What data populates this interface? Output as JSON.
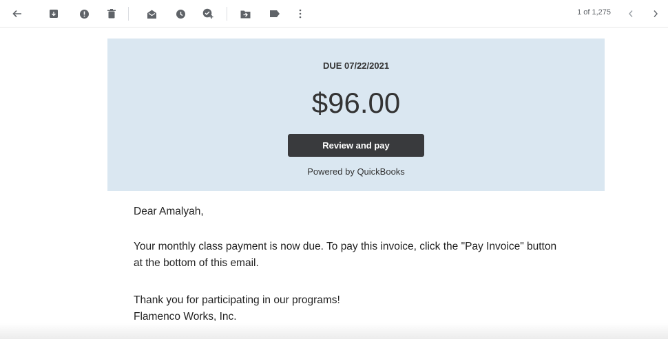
{
  "toolbar": {
    "icons": [
      "back-arrow-icon",
      "archive-icon",
      "report-spam-icon",
      "delete-icon",
      "mark-unread-icon",
      "snooze-icon",
      "add-task-icon",
      "move-to-icon",
      "label-icon",
      "more-icon"
    ],
    "counter": "1 of 1,275",
    "prev_label": "<",
    "next_label": ">"
  },
  "invoice": {
    "due": "DUE 07/22/2021",
    "amount": "$96.00",
    "button": "Review and pay",
    "powered": "Powered by QuickBooks",
    "background": "#dae7f1",
    "button_color": "#393a3d"
  },
  "message": {
    "greeting": "Dear Amalyah,",
    "paragraph_line1": "Your monthly class payment is now due. To pay this invoice, click the \"Pay Invoice\" button",
    "paragraph_line2": "at the bottom of this email.",
    "thanks": "Thank you for participating in our programs!",
    "signature": "Flamenco Works, Inc."
  }
}
